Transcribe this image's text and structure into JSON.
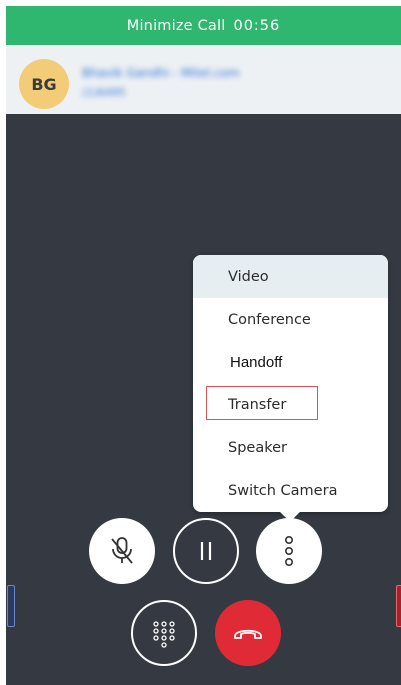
{
  "top_bar": {
    "label": "Minimize Call",
    "timer": "00:56",
    "color": "#2fb66f"
  },
  "caller": {
    "initials": "BG",
    "name": "Bhavik Gandhi - Mitel.com",
    "number": "(1)6495"
  },
  "menu": {
    "items": [
      {
        "label": "Video"
      },
      {
        "label": "Conference"
      },
      {
        "label": "Handoff"
      },
      {
        "label": "Transfer"
      },
      {
        "label": "Speaker"
      },
      {
        "label": "Switch Camera"
      }
    ]
  },
  "controls": {
    "icons": [
      "mic-off-icon",
      "pause-icon",
      "more-vertical-icon",
      "dialpad-icon",
      "phone-hangup-icon"
    ],
    "end_call_color": "#e02b36"
  }
}
